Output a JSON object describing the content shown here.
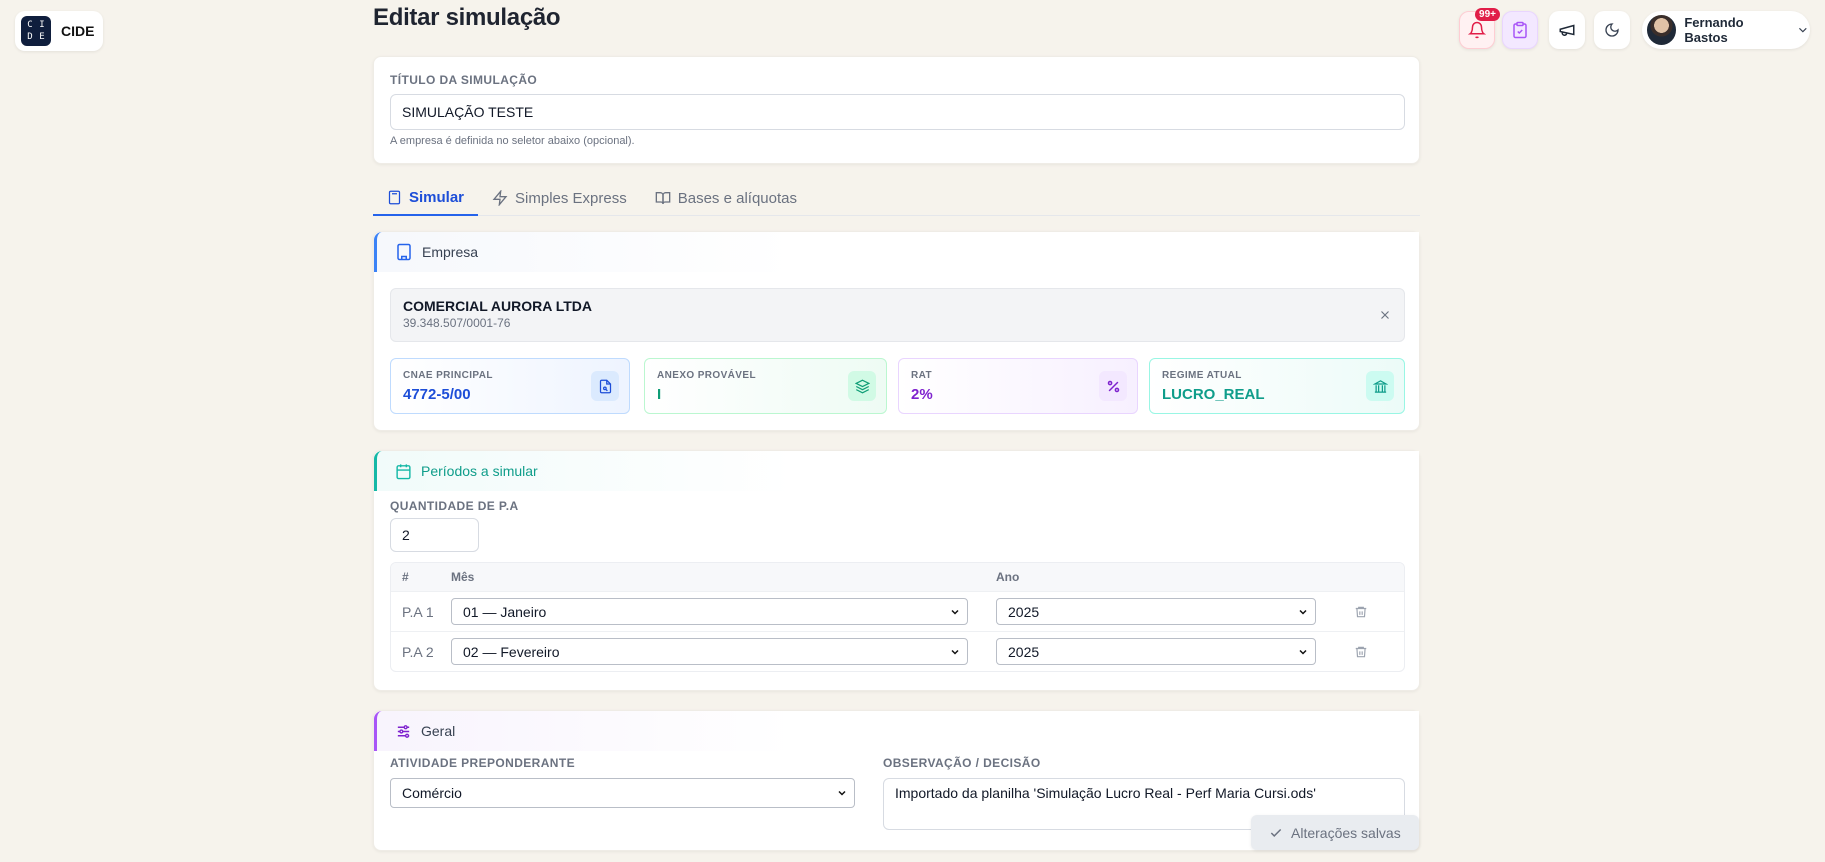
{
  "logo": {
    "letters": [
      "C",
      "I",
      "D",
      "E"
    ],
    "text": "CIDE"
  },
  "page_title": "Editar simulação",
  "header": {
    "notifications_badge": "99+",
    "user_name": "Fernando Bastos"
  },
  "title_card": {
    "label": "TÍTULO DA SIMULAÇÃO",
    "value": "SIMULAÇÃO TESTE",
    "hint": "A empresa é definida no seletor abaixo (opcional)."
  },
  "tabs": [
    {
      "label": "Simular",
      "active": true
    },
    {
      "label": "Simples Express",
      "active": false
    },
    {
      "label": "Bases e alíquotas",
      "active": false
    }
  ],
  "empresa": {
    "heading": "Empresa",
    "name": "COMERCIAL AURORA LTDA",
    "cnpj": "39.348.507/0001-76",
    "metrics": [
      {
        "label": "CNAE PRINCIPAL",
        "value": "4772-5/00",
        "color": "#1d4ed8"
      },
      {
        "label": "ANEXO PROVÁVEL",
        "value": "I",
        "color": "#0f9d76"
      },
      {
        "label": "RAT",
        "value": "2%",
        "color": "#7e22ce"
      },
      {
        "label": "REGIME ATUAL",
        "value": "LUCRO_REAL",
        "color": "#0f9d8a"
      }
    ]
  },
  "periodos": {
    "heading": "Períodos a simular",
    "qty_label": "QUANTIDADE DE P.A",
    "qty_value": "2",
    "columns": {
      "num": "#",
      "month": "Mês",
      "year": "Ano"
    },
    "rows": [
      {
        "label": "P.A 1",
        "month": "01 — Janeiro",
        "year": "2025"
      },
      {
        "label": "P.A 2",
        "month": "02 — Fevereiro",
        "year": "2025"
      }
    ]
  },
  "geral": {
    "heading": "Geral",
    "atividade_label": "ATIVIDADE PREPONDERANTE",
    "atividade_value": "Comércio",
    "obs_label": "OBSERVAÇÃO / DECISÃO",
    "obs_value": "Importado da planilha 'Simulação Lucro Real - Perf Maria Cursi.ods'"
  },
  "toast": "Alterações salvas"
}
